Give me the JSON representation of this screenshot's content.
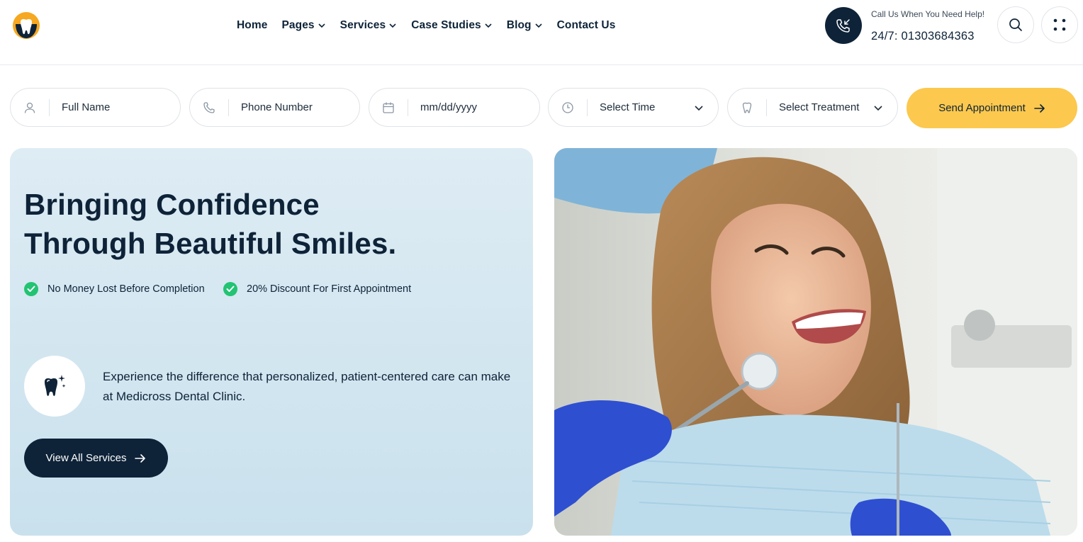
{
  "header": {
    "logo_icon": "tooth-logo-icon",
    "nav": [
      {
        "label": "Home",
        "has_dropdown": false
      },
      {
        "label": "Pages",
        "has_dropdown": true
      },
      {
        "label": "Services",
        "has_dropdown": true
      },
      {
        "label": "Case Studies",
        "has_dropdown": true
      },
      {
        "label": "Blog",
        "has_dropdown": true
      },
      {
        "label": "Contact Us",
        "has_dropdown": false
      }
    ],
    "call": {
      "label": "Call Us When You Need Help!",
      "number": "24/7: 01303684363",
      "icon": "phone-incoming-icon"
    },
    "search_icon": "search-icon",
    "menu_icon": "grid-dots-icon"
  },
  "appointment": {
    "full_name": {
      "placeholder": "Full Name",
      "icon": "user-icon"
    },
    "phone": {
      "placeholder": "Phone Number",
      "icon": "phone-icon"
    },
    "date": {
      "placeholder": "mm/dd/yyyy",
      "icon": "calendar-icon"
    },
    "time": {
      "value": "Select Time",
      "icon": "clock-icon"
    },
    "treatment": {
      "value": "Select Treatment",
      "icon": "tooth-icon"
    },
    "submit_label": "Send Appointment"
  },
  "hero": {
    "title_line1": "Bringing Confidence",
    "title_line2": "Through Beautiful Smiles.",
    "checks": [
      "No Money Lost Before Completion",
      "20% Discount For First Appointment"
    ],
    "description": "Experience the difference that personalized, patient-centered care can make at Medicross Dental Clinic.",
    "cta_label": "View All Services"
  },
  "colors": {
    "navy": "#0e2338",
    "accent_yellow": "#fcc84d",
    "check_green": "#22c373",
    "hero_bg": "#d3e6f0"
  }
}
